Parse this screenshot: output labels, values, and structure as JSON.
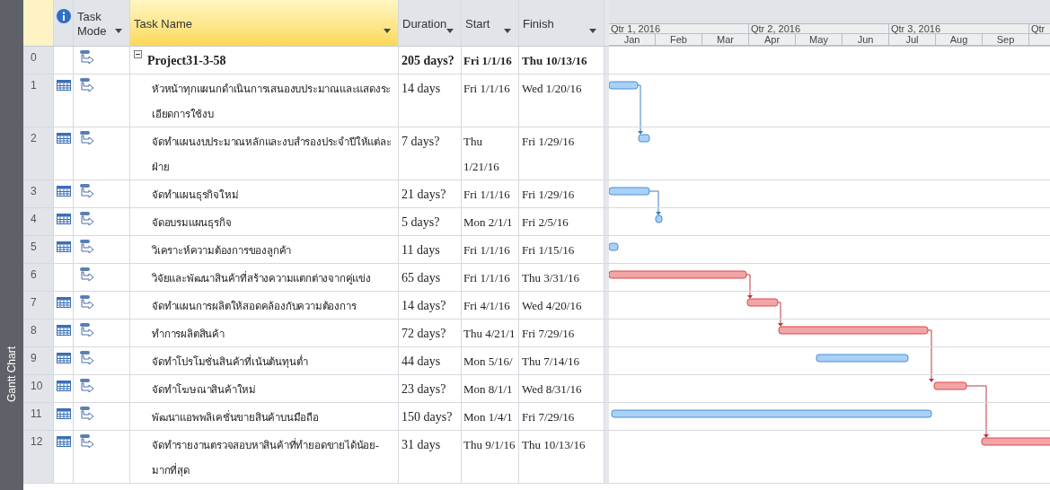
{
  "view_tab": {
    "label": "Gantt Chart"
  },
  "columns": [
    {
      "label": "Task Mode",
      "selected": false
    },
    {
      "label": "Task Name",
      "selected": true
    },
    {
      "label": "Duration",
      "selected": false
    },
    {
      "label": "Start",
      "selected": false
    },
    {
      "label": "Finish",
      "selected": false
    }
  ],
  "timescale": {
    "quarters": [
      "Qtr 1, 2016",
      "Qtr 2, 2016",
      "Qtr 3, 2016",
      "Qtr"
    ],
    "months": [
      "Jan",
      "Feb",
      "Mar",
      "Apr",
      "May",
      "Jun",
      "Jul",
      "Aug",
      "Sep"
    ]
  },
  "tasks": [
    {
      "id": "0",
      "kind": "summary",
      "expanded": true,
      "calendar": false,
      "name": "Project31-3-58",
      "duration": "205 days?",
      "start": "Fri 1/1/16",
      "finish": "Thu 10/13/16"
    },
    {
      "id": "1",
      "kind": "task",
      "calendar": true,
      "critical": false,
      "name": "หัวหน้าทุกแผนกดำเนินการเสนองบประมาณและแสดงระเอียดการใช้งบ",
      "duration": "14 days",
      "start": "Fri 1/1/16",
      "finish": "Wed 1/20/16"
    },
    {
      "id": "2",
      "kind": "task",
      "calendar": true,
      "critical": false,
      "name": "จัดทำแผนงบประมาณหลักและงบสำรองประจำปีให้แต่ละฝ่าย",
      "duration": "7 days?",
      "start": "Thu 1/21/16",
      "finish": "Fri 1/29/16"
    },
    {
      "id": "3",
      "kind": "task",
      "calendar": true,
      "critical": false,
      "name": "จัดทำแผนธุรกิจใหม่",
      "duration": "21 days?",
      "start": "Fri 1/1/16",
      "finish": "Fri 1/29/16"
    },
    {
      "id": "4",
      "kind": "task",
      "calendar": true,
      "critical": false,
      "name": "จัดอบรมแผนธุรกิจ",
      "duration": "5 days?",
      "start": "Mon 2/1/1",
      "finish": "Fri 2/5/16"
    },
    {
      "id": "5",
      "kind": "task",
      "calendar": true,
      "critical": false,
      "name": "วิเคราะห์ความต้องการของลูกค้า",
      "duration": "11 days",
      "start": "Fri 1/1/16",
      "finish": "Fri 1/15/16"
    },
    {
      "id": "6",
      "kind": "task",
      "calendar": false,
      "critical": true,
      "name": "วิจัยและพัฒนาสินค้าที่สร้างความแตกต่างจากคู่แข่ง",
      "duration": "65 days",
      "start": "Fri 1/1/16",
      "finish": "Thu 3/31/16"
    },
    {
      "id": "7",
      "kind": "task",
      "calendar": true,
      "critical": true,
      "name": "จัดทำแผนการผลิตให้สอดคล้องกับความต้องการ",
      "duration": "14 days?",
      "start": "Fri 4/1/16",
      "finish": "Wed 4/20/16"
    },
    {
      "id": "8",
      "kind": "task",
      "calendar": true,
      "critical": true,
      "name": "ทำการผลิตสินค้า",
      "duration": "72 days?",
      "start": "Thu 4/21/1",
      "finish": "Fri 7/29/16"
    },
    {
      "id": "9",
      "kind": "task",
      "calendar": true,
      "critical": false,
      "name": "จัดทำโปรโมชั่นสินค้าที่เน้นต้นทุนต่ำ",
      "duration": "44 days",
      "start": "Mon 5/16/",
      "finish": "Thu 7/14/16"
    },
    {
      "id": "10",
      "kind": "task",
      "calendar": true,
      "critical": true,
      "name": "จัดทำโฆษณาสินค้าใหม่",
      "duration": "23 days?",
      "start": "Mon 8/1/1",
      "finish": "Wed 8/31/16"
    },
    {
      "id": "11",
      "kind": "task",
      "calendar": true,
      "critical": false,
      "name": "พัฒนาแอพพลิเคชั่นขายสินค้าบนมือถือ",
      "duration": "150 days?",
      "start": "Mon 1/4/1",
      "finish": "Fri 7/29/16"
    },
    {
      "id": "12",
      "kind": "task",
      "calendar": true,
      "critical": true,
      "name": "จัดทำรายงานตรวจสอบหาสินค้าที่ทำยอดขายได้น้อย-มากที่สุด",
      "duration": "31 days",
      "start": "Thu 9/1/16",
      "finish": "Thu 10/13/16"
    }
  ]
}
